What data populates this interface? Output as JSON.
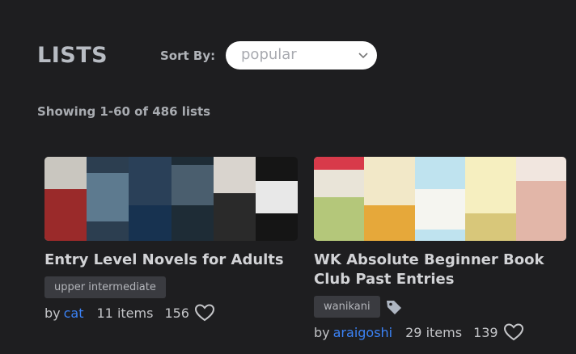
{
  "header": {
    "title": "LISTS",
    "sort_label": "Sort By:",
    "sort_value": "popular"
  },
  "summary": "Showing 1-60 of 486 lists",
  "lists": [
    {
      "title": "Entry Level Novels for Adults",
      "tags": [
        "upper intermediate"
      ],
      "by_label": "by",
      "author": "cat",
      "items": "11 items",
      "likes": "156"
    },
    {
      "title": "WK Absolute Beginner Book Club Past Entries",
      "tags": [
        "wanikani"
      ],
      "by_label": "by",
      "author": "araigoshi",
      "items": "29 items",
      "likes": "139"
    }
  ],
  "icons": {
    "sort": "chevron-down-icon",
    "tag": "tag-icon",
    "like": "heart-icon"
  },
  "colors": {
    "background": "#1e1e20",
    "link": "#3b82f6",
    "tag_bg": "#3a3b40"
  }
}
